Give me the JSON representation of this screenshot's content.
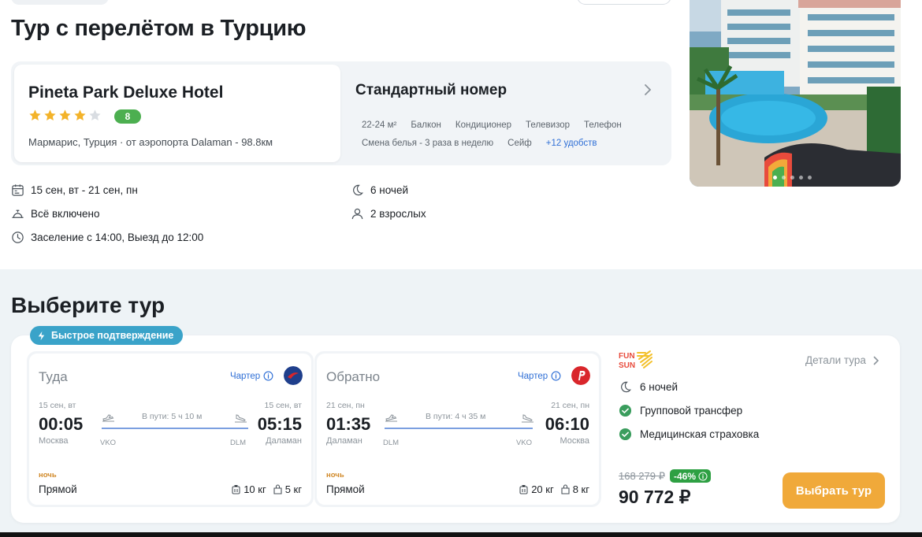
{
  "page": {
    "title": "Тур с перелётом в Турцию"
  },
  "hotel": {
    "name": "Pineta Park Deluxe Hotel",
    "stars": 4,
    "stars_max": 5,
    "rating": "8",
    "location": "Мармарис, Турция · от аэропорта Dalaman - 98.8км",
    "photo_count": 5,
    "photo_active": 0
  },
  "room": {
    "title": "Стандартный номер",
    "amenities": [
      "22-24 м²",
      "Балкон",
      "Кондиционер",
      "Телевизор",
      "Телефон",
      "Смена белья - 3 раза в неделю",
      "Сейф"
    ],
    "more_amenities": "+12 удобств"
  },
  "details": {
    "dates": "15 сен, вт - 21 сен, пн",
    "board": "Всё включено",
    "checkin": "Заселение с 14:00, Выезд до 12:00",
    "nights": "6 ночей",
    "guests": "2 взрослых"
  },
  "choose": {
    "title": "Выберите тур",
    "badge": "Быстрое подтверждение"
  },
  "flights": [
    {
      "title": "Туда",
      "charter": "Чартер",
      "dep_date": "15 сен, вт",
      "dep_time": "00:05",
      "dep_city": "Москва",
      "dep_code": "VKO",
      "duration": "В пути: 5 ч 10 м",
      "arr_date": "15 сен, вт",
      "arr_time": "05:15",
      "arr_city": "Даламан",
      "arr_code": "DLM",
      "time_of_day": "ночь",
      "type": "Прямой",
      "baggage": "10 кг",
      "hand_luggage": "5 кг",
      "airline_color": "#1f3f8c"
    },
    {
      "title": "Обратно",
      "charter": "Чартер",
      "dep_date": "21 сен, пн",
      "dep_time": "01:35",
      "dep_city": "Даламан",
      "dep_code": "DLM",
      "duration": "В пути: 4 ч 35 м",
      "arr_date": "21 сен, пн",
      "arr_time": "06:10",
      "arr_city": "Москва",
      "arr_code": "VKO",
      "time_of_day": "ночь",
      "type": "Прямой",
      "baggage": "20 кг",
      "hand_luggage": "8 кг",
      "airline_color": "#d9262b"
    }
  ],
  "tour": {
    "operator_logo": "FUN SUN",
    "details_link": "Детали тура",
    "features": [
      "6 ночей",
      "Групповой трансфер",
      "Медицинская страховка"
    ],
    "old_price": "168 279 ₽",
    "discount": "-46%",
    "price": "90 772 ₽",
    "cta": "Выбрать тур"
  },
  "colors": {
    "accent": "#f0a93a",
    "link": "#2f6fd6",
    "success": "#2ea043",
    "badge": "#3aa3c9"
  }
}
